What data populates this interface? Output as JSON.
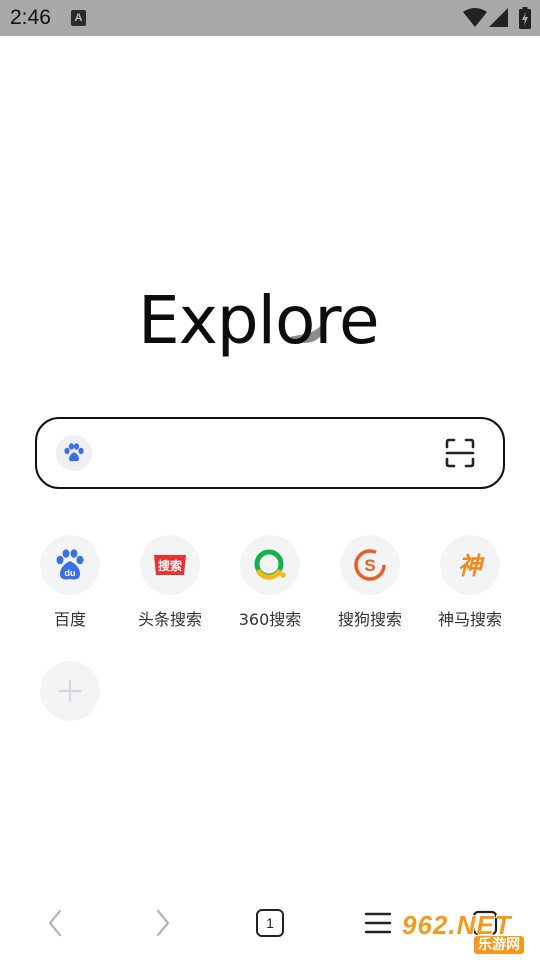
{
  "status_bar": {
    "time": "2:46",
    "notification_icon": "A"
  },
  "logo": {
    "text": "Explore"
  },
  "search": {
    "placeholder": "",
    "value": "",
    "engine_icon": "baidu-paw-icon",
    "scan_icon": "scan-icon"
  },
  "quick_links": [
    {
      "label": "百度",
      "icon": "baidu-icon",
      "icon_text": "du",
      "color": "#3a6fe8"
    },
    {
      "label": "头条搜索",
      "icon": "toutiao-icon",
      "icon_text": "搜索",
      "color": "#e8322d"
    },
    {
      "label": "360搜索",
      "icon": "360-icon",
      "color": "#18b04f"
    },
    {
      "label": "搜狗搜索",
      "icon": "sogou-icon",
      "icon_text": "S",
      "color": "#f25b1f"
    },
    {
      "label": "神马搜索",
      "icon": "shenma-icon",
      "icon_text": "神",
      "color": "#f08a1c"
    }
  ],
  "bottom_nav": {
    "tab_count": "1"
  },
  "watermark": {
    "top": "962.NET",
    "bottom": "乐游网"
  }
}
